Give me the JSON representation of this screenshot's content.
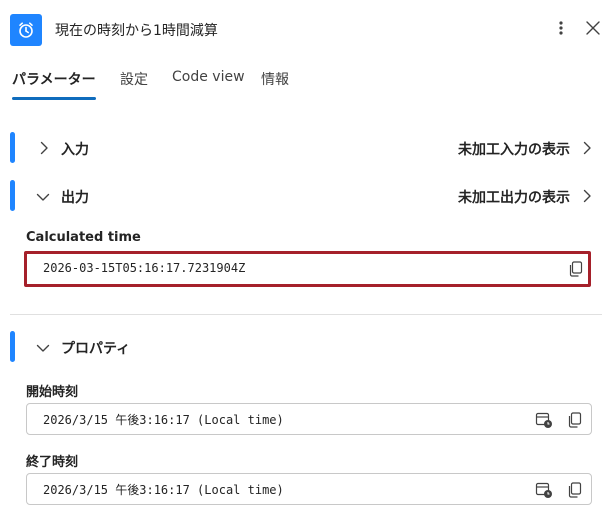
{
  "header": {
    "title": "現在の時刻から1時間減算",
    "app_icon": "alarm-clock-icon",
    "accent_color": "#1f85ff"
  },
  "tabs": [
    {
      "label": "パラメーター",
      "active": true
    },
    {
      "label": "設定",
      "active": false
    },
    {
      "label": "Code view",
      "active": false
    },
    {
      "label": "情報",
      "active": false
    }
  ],
  "sections": {
    "input": {
      "label": "入力",
      "raw_link": "未加工入力の表示",
      "expanded": false
    },
    "output": {
      "label": "出力",
      "raw_link": "未加工出力の表示",
      "expanded": true
    },
    "properties": {
      "label": "プロパティ",
      "expanded": true
    }
  },
  "output_fields": {
    "calculated_time": {
      "label": "Calculated time",
      "value": "2026-03-15T05:16:17.7231904Z",
      "highlight_color": "#a5202a"
    }
  },
  "property_fields": {
    "start_time": {
      "label": "開始時刻",
      "value": "2026/3/15 午後3:16:17 (Local time)"
    },
    "end_time": {
      "label": "終了時刻",
      "value": "2026/3/15 午後3:16:17 (Local time)"
    }
  }
}
